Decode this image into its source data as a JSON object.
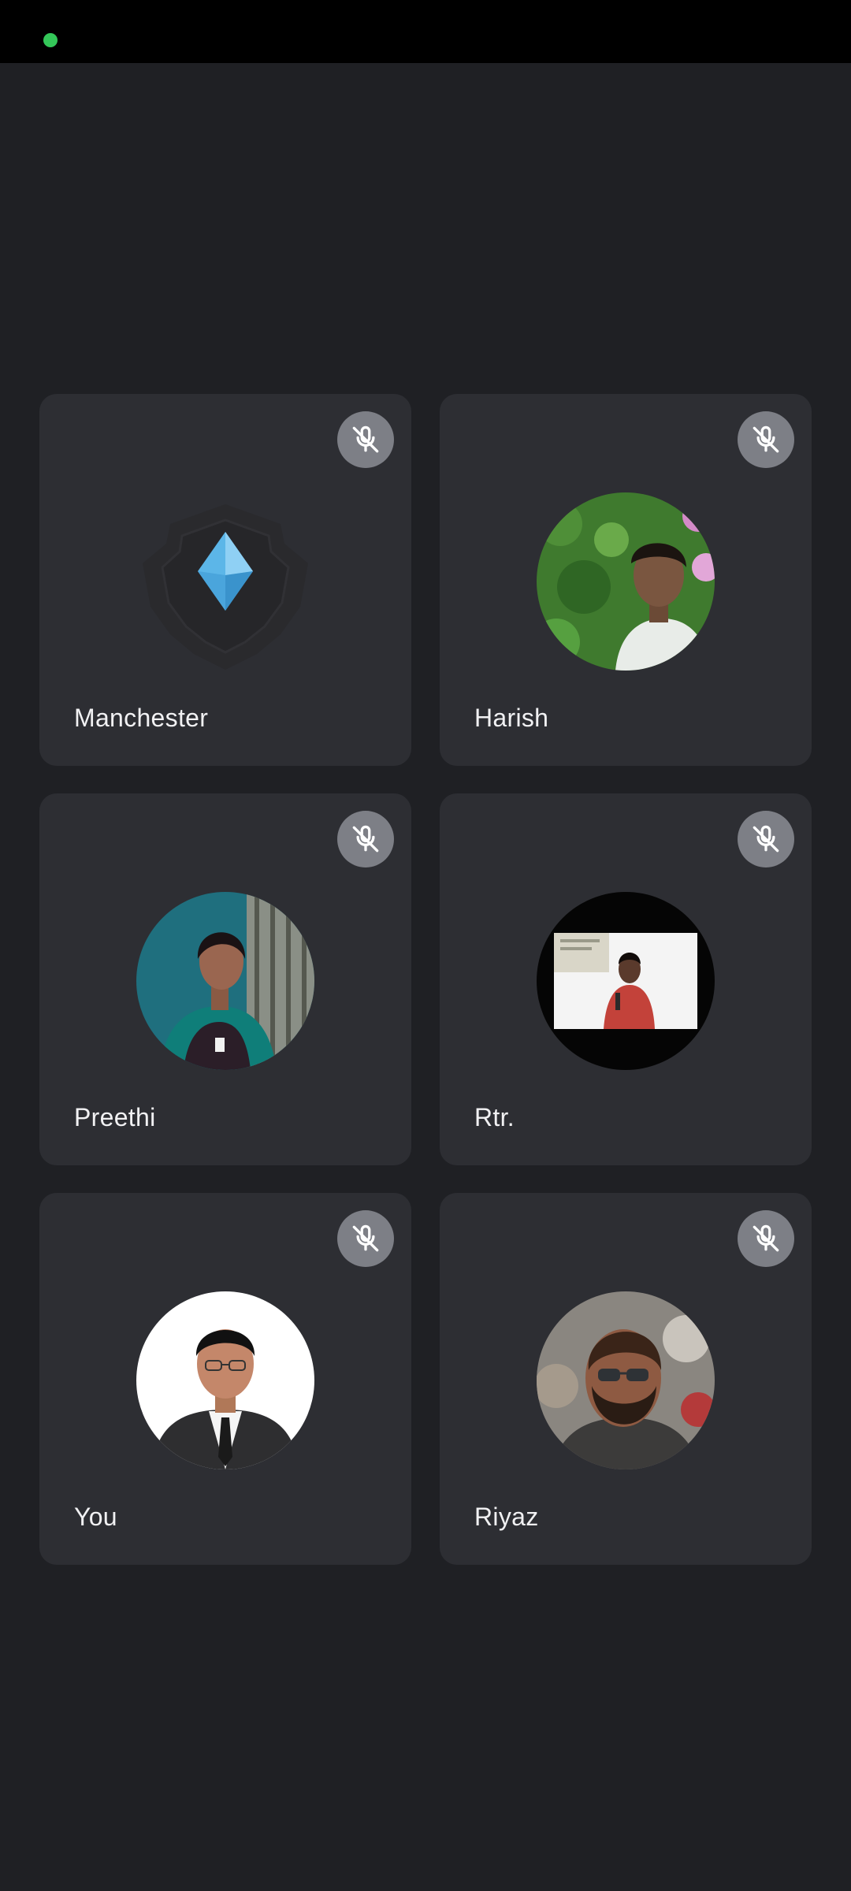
{
  "status_bar": {
    "indicator_color": "#34c759"
  },
  "participants": [
    {
      "name": "Manchester",
      "mic": "muted",
      "avatar": "crest-logo-icon"
    },
    {
      "name": "Harish",
      "mic": "muted",
      "avatar": "photo"
    },
    {
      "name": "Preethi",
      "mic": "muted",
      "avatar": "photo"
    },
    {
      "name": "Rtr.",
      "mic": "muted",
      "avatar": "photo"
    },
    {
      "name": "You",
      "mic": "muted",
      "avatar": "photo"
    },
    {
      "name": "Riyaz",
      "mic": "muted",
      "avatar": "photo"
    }
  ],
  "colors": {
    "background": "#1f2024",
    "tile": "#2d2e33",
    "mute_button": "#7d7f86",
    "text": "#f1f1f3"
  }
}
